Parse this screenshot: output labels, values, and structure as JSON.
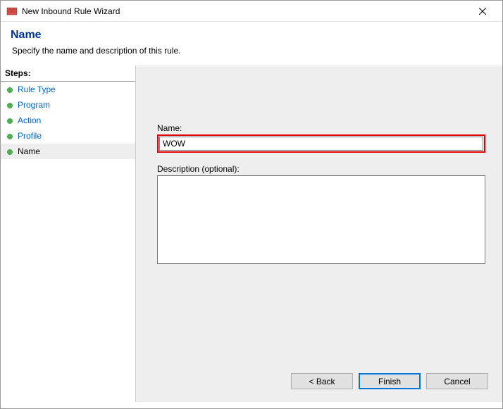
{
  "window": {
    "title": "New Inbound Rule Wizard"
  },
  "header": {
    "title": "Name",
    "subtitle": "Specify the name and description of this rule."
  },
  "sidebar": {
    "steps_label": "Steps:",
    "items": [
      {
        "label": "Rule Type",
        "current": false
      },
      {
        "label": "Program",
        "current": false
      },
      {
        "label": "Action",
        "current": false
      },
      {
        "label": "Profile",
        "current": false
      },
      {
        "label": "Name",
        "current": true
      }
    ]
  },
  "form": {
    "name_label": "Name:",
    "name_value": "WOW",
    "description_label": "Description (optional):",
    "description_value": ""
  },
  "buttons": {
    "back": "< Back",
    "finish": "Finish",
    "cancel": "Cancel"
  }
}
